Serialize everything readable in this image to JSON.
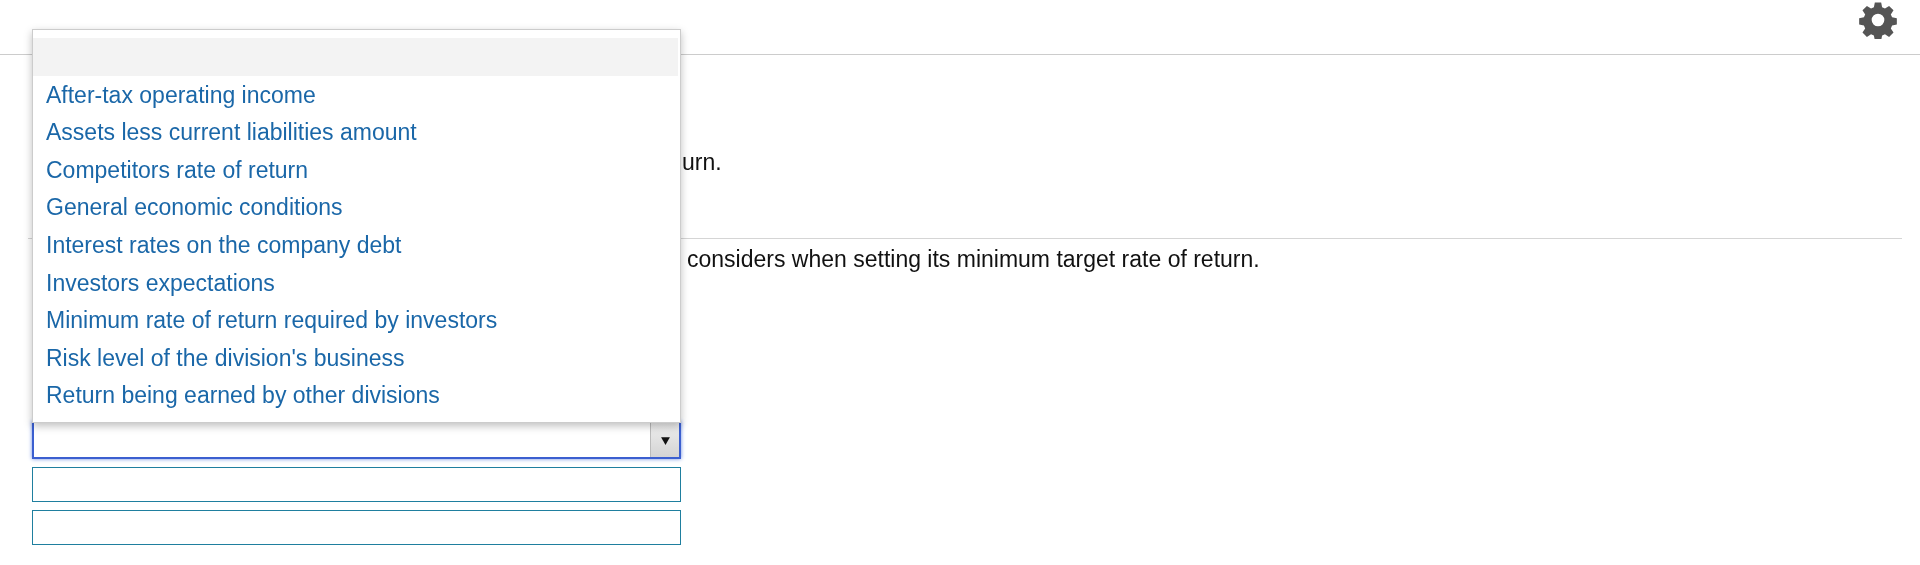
{
  "text_fragments": [
    {
      "text": "urn.",
      "divider_above": false
    },
    {
      "text": "considers when setting its minimum target rate of return.",
      "divider_above": true
    }
  ],
  "dropdown": {
    "expanded": true,
    "focused": true,
    "options": [
      {
        "label": "After-tax operating income",
        "selected": false
      },
      {
        "label": "Assets less current liabilities amount",
        "selected": false
      },
      {
        "label": "Competitors rate of return",
        "selected": false
      },
      {
        "label": "General economic conditions",
        "selected": false
      },
      {
        "label": "Interest rates on the company debt",
        "selected": false
      },
      {
        "label": "Investors expectations",
        "selected": false
      },
      {
        "label": "Minimum rate of return required by investors",
        "selected": false
      },
      {
        "label": "Risk level of the division's business",
        "selected": false
      },
      {
        "label": "Return being earned by other divisions",
        "selected": false
      }
    ]
  },
  "answer_fields": [
    {
      "kind": "text"
    },
    {
      "kind": "text"
    }
  ]
}
